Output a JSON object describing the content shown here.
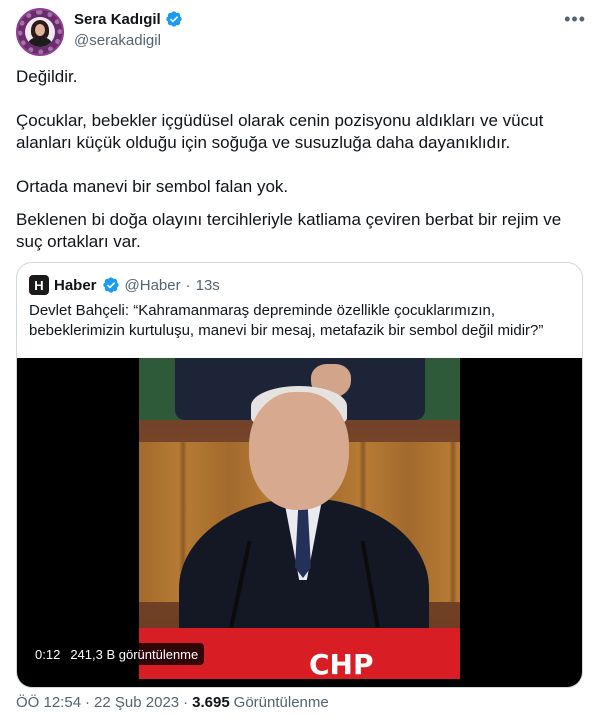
{
  "tweet": {
    "author": {
      "display_name": "Sera Kadıgil",
      "handle": "@serakadigil",
      "verified_icon": "verified-badge-icon"
    },
    "more_icon": "more-horizontal-icon",
    "paragraphs": [
      "Değildir.",
      "Çocuklar, bebekler içgüdüsel olarak cenin pozisyonu aldıkları ve vücut alanları küçük olduğu için soğuğa ve susuzluğa daha dayanıklıdır.",
      "Ortada manevi bir sembol falan yok.",
      "Beklenen bi doğa olayını tercihleriyle katliama çeviren berbat bir rejim ve suç ortakları var."
    ],
    "quote": {
      "logo_letter": "H",
      "display_name": "Haber",
      "handle": "@Haber",
      "separator": "·",
      "time": "13s",
      "text": "Devlet Bahçeli: “Kahramanmaraş depreminde özellikle çocuklarımızın, bebeklerimizin kurtuluşu, manevi bir mesaj, metafazik bir sembol değil midir?”",
      "video": {
        "duration": "0:12",
        "views": "241,3 B görüntülenme",
        "banner_text": "CHP"
      }
    },
    "footer": {
      "time": "ÖÖ 12:54",
      "separator1": "·",
      "date": "22 Şub 2023",
      "separator2": "·",
      "views_count": "3.695",
      "views_label": "Görüntülenme"
    }
  },
  "colors": {
    "verified": "#1d9bf0",
    "secondary_text": "#536471",
    "border": "#cfd9de"
  }
}
